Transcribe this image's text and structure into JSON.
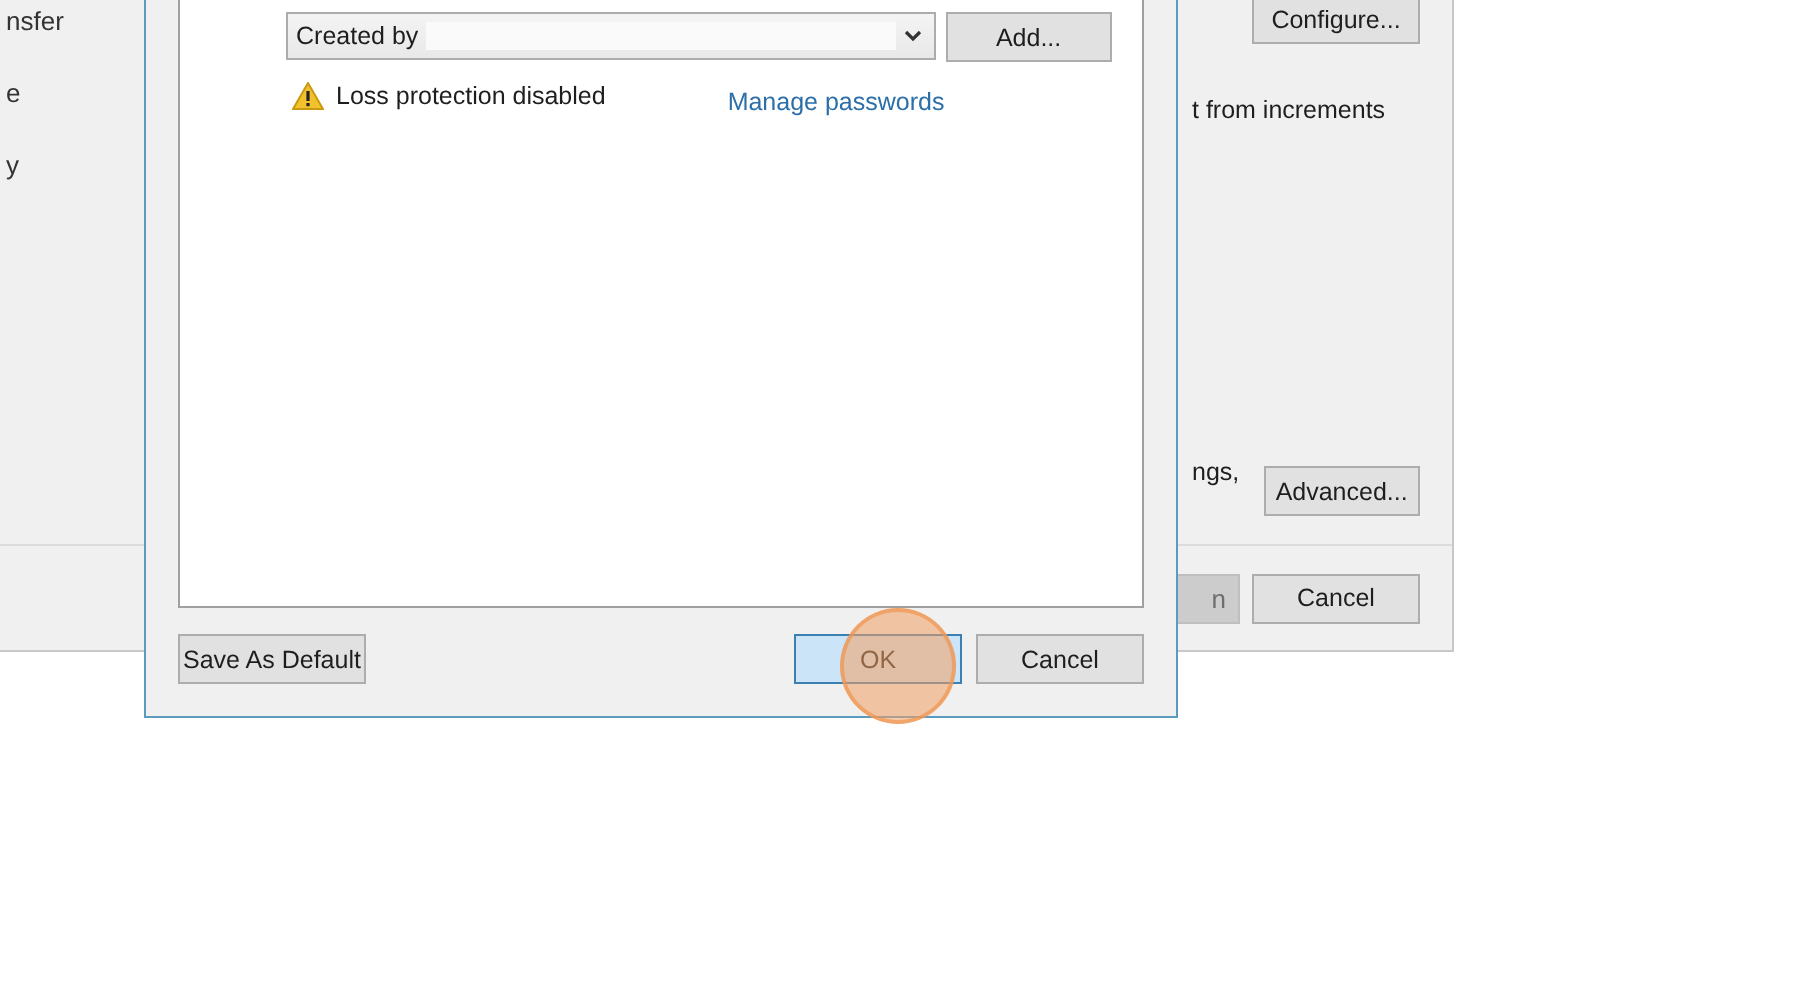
{
  "background_window": {
    "sidebar_items": [
      "nsfer",
      "e",
      "y"
    ],
    "configure_button": "Configure...",
    "increments_text": "t from increments",
    "settings_text": "ngs,",
    "advanced_button": "Advanced...",
    "bottom_buttons": [
      {
        "label": "n",
        "disabled": true
      },
      {
        "label": "Cancel",
        "disabled": false
      }
    ]
  },
  "dialog": {
    "password_select": {
      "value": "Created by"
    },
    "add_button": "Add...",
    "warning": "Loss protection disabled",
    "manage_link": "Manage passwords",
    "save_default_button": "Save As Default",
    "buttons": [
      {
        "label": "OK",
        "focused": true
      },
      {
        "label": "Cancel",
        "focused": false
      }
    ],
    "click_indicator": true
  }
}
